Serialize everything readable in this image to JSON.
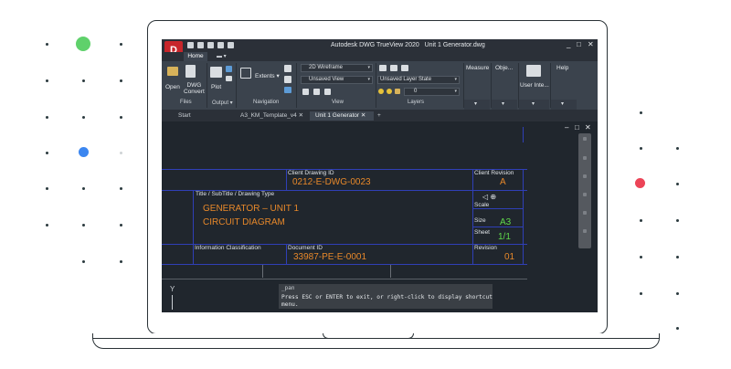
{
  "app": {
    "title": "Autodesk DWG TrueView 2020",
    "file_name": "Unit 1 Generator.dwg",
    "logo_letter": "D",
    "window_controls": [
      "_",
      "□",
      "✕"
    ]
  },
  "ribbon": {
    "tabs": [
      "Home"
    ],
    "extra_tab_icon": "camera-icon",
    "buttons": {
      "open": "Open",
      "dwg_convert": "DWG\nConvert",
      "plot": "Plot",
      "extents": "Extents"
    },
    "panels": {
      "files": "Files",
      "output": "Output",
      "navigation": "Navigation",
      "view": "View",
      "layers": "Layers",
      "measure": "Measure",
      "objects": "Obje...",
      "user_interface": "User Inte...",
      "help": "Help"
    },
    "dropdowns": {
      "visual_style": "2D Wireframe",
      "view": "Unsaved View",
      "layer_state": "Unsaved Layer State",
      "layer": "0"
    }
  },
  "document_tabs": [
    {
      "label": "Start",
      "active": false
    },
    {
      "label": "A3_KM_Template_v4",
      "active": false
    },
    {
      "label": "Unit 1 Generator",
      "active": true
    }
  ],
  "document_tab_close": "✕",
  "add_tab": "+",
  "drawing": {
    "client_drawing_id_label": "Client Drawing ID",
    "client_drawing_id": "0212-E-DWG-0023",
    "client_revision_label": "Client Revision",
    "client_revision": "A",
    "title_label": "Title / SubTitle / Drawing Type",
    "title_line1": "GENERATOR – UNIT 1",
    "title_line2": "CIRCUIT DIAGRAM",
    "scale_label": "Scale",
    "size_label": "Size",
    "size_value": "A3",
    "sheet_label": "Sheet",
    "sheet_value": "1/1",
    "info_class_label": "Information Classification",
    "document_id_label": "Document ID",
    "document_id": "33987-PE-E-0001",
    "revision_label": "Revision",
    "revision": "01",
    "line_color": "#2f3fb7",
    "title_color": "#e7882a",
    "size_color": "#5fd84a"
  },
  "viewport_controls": [
    "–",
    "□",
    "✕"
  ],
  "ucs_label": "Y",
  "command": {
    "history_label": "_pan",
    "message": "Press ESC or ENTER to exit, or right-click to display shortcut menu."
  }
}
